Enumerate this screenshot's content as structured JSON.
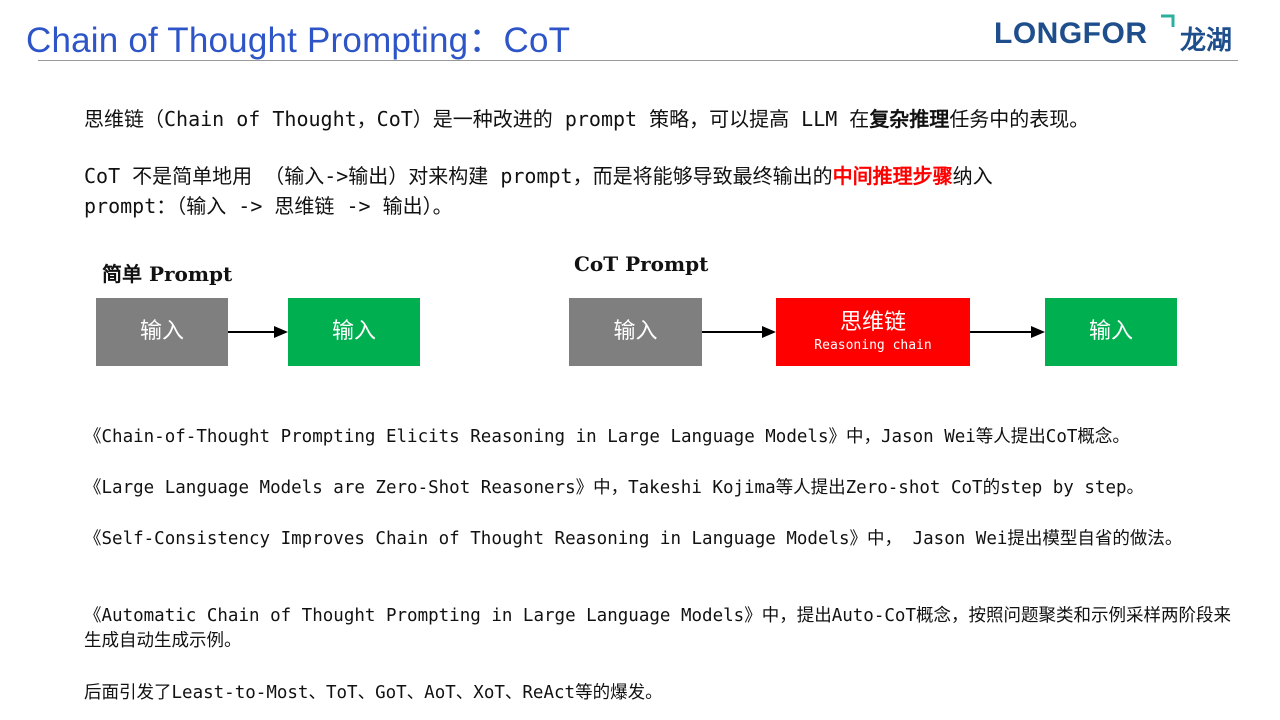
{
  "header": {
    "title": "Chain of Thought Prompting：CoT",
    "logo_en": "LONGFOR",
    "logo_cn": "龙湖"
  },
  "intro": {
    "p1_pre": "思维链（Chain of Thought，CoT）是一种改进的 prompt 策略，可以提高 LLM 在",
    "p1_bold": "复杂推理",
    "p1_post": "任务中的表现。",
    "p2_pre": "CoT 不是简单地用 （输入->输出）对来构建 prompt，而是将能够导致最终输出的",
    "p2_red": "中间推理步骤",
    "p2_post": "纳入",
    "p2_line2": "prompt：（输入 -> 思维链 -> 输出）。"
  },
  "diagram": {
    "simple_label": "简单 Prompt",
    "simple_input": "输入",
    "simple_output": "输入",
    "cot_label": "CoT Prompt",
    "cot_input": "输入",
    "cot_chain": "思维链",
    "cot_chain_en": "Reasoning chain",
    "cot_output": "输入"
  },
  "references": [
    "《Chain-of-Thought Prompting Elicits Reasoning in Large Language Models》中，Jason Wei等人提出CoT概念。",
    "《Large Language Models are Zero-Shot Reasoners》中，Takeshi Kojima等人提出Zero-shot CoT的step by step。",
    "《Self-Consistency Improves Chain of Thought Reasoning in Language Models》中， Jason Wei提出模型自省的做法。",
    "《Automatic Chain of Thought Prompting in Large Language Models》中，提出Auto-CoT概念，按照问题聚类和示例采样两阶段来生成自动生成示例。",
    "后面引发了Least-to-Most、ToT、GoT、AoT、XoT、ReAct等的爆发。"
  ],
  "colors": {
    "title": "#2d55c8",
    "logo": "#1f4e8c",
    "logo_accent": "#2bb0a0",
    "gray_box": "#7f7f7f",
    "green_box": "#00b050",
    "red_box": "#ff0000",
    "highlight_red": "#ff0000"
  }
}
